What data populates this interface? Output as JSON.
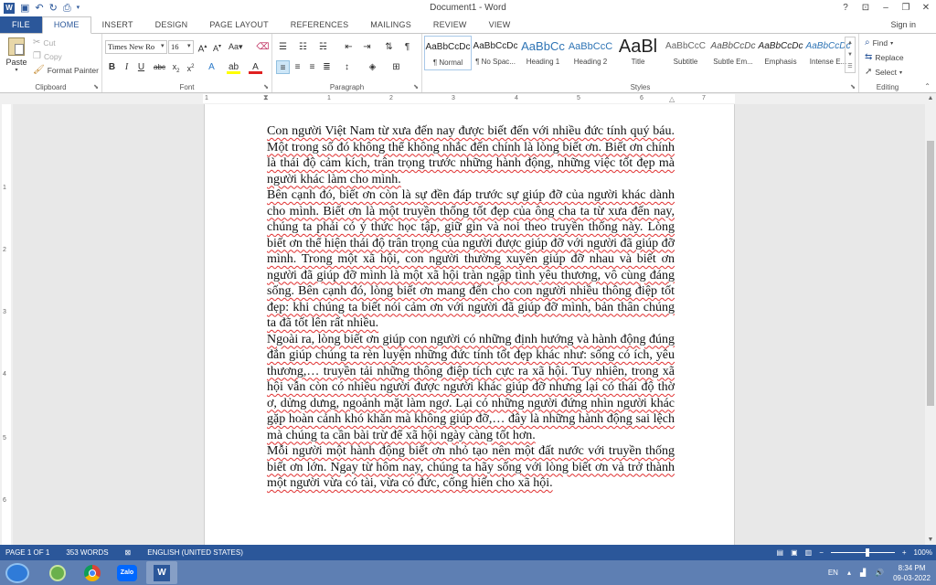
{
  "app": {
    "title": "Document1 - Word",
    "signin": "Sign in"
  },
  "colors": {
    "accent": "#2b579a",
    "taskbar": "#5e7fb3",
    "spell_error": "#e03030"
  },
  "quick_access": [
    "word-icon",
    "save-icon",
    "undo-icon",
    "redo-icon",
    "print-preview-icon"
  ],
  "tabs": [
    "FILE",
    "HOME",
    "INSERT",
    "DESIGN",
    "PAGE LAYOUT",
    "REFERENCES",
    "MAILINGS",
    "REVIEW",
    "VIEW"
  ],
  "ribbon": {
    "clipboard": {
      "label": "Clipboard",
      "paste": "Paste",
      "cut": "Cut",
      "copy": "Copy",
      "format_painter": "Format Painter"
    },
    "font": {
      "label": "Font",
      "name": "Times New Ro",
      "size": "16"
    },
    "paragraph": {
      "label": "Paragraph"
    },
    "styles": {
      "label": "Styles",
      "items": [
        {
          "preview": "AaBbCcDc",
          "name": "¶ Normal"
        },
        {
          "preview": "AaBbCcDc",
          "name": "¶ No Spac..."
        },
        {
          "preview": "AaBbCc",
          "name": "Heading 1"
        },
        {
          "preview": "AaBbCcC",
          "name": "Heading 2"
        },
        {
          "preview": "AaBl",
          "name": "Title"
        },
        {
          "preview": "AaBbCcC",
          "name": "Subtitle"
        },
        {
          "preview": "AaBbCcDc",
          "name": "Subtle Em..."
        },
        {
          "preview": "AaBbCcDc",
          "name": "Emphasis"
        },
        {
          "preview": "AaBbCcDc",
          "name": "Intense E..."
        }
      ]
    },
    "editing": {
      "label": "Editing",
      "find": "Find",
      "replace": "Replace",
      "select": "Select"
    }
  },
  "ruler": {
    "h_numbers": [
      "1",
      "1",
      "2",
      "3",
      "4",
      "5",
      "6",
      "7"
    ],
    "v_numbers": [
      "1",
      "2",
      "3",
      "4",
      "5",
      "6"
    ]
  },
  "document": {
    "paragraphs": [
      "Con người Việt Nam từ xưa đến nay được biết đến với nhiều đức tính quý báu. Một trong số đó không thể không nhắc đến chính là lòng biết ơn. Biết ơn chính là thái độ cảm kích, trân trọng trước những hành động, những việc tốt đẹp mà người khác làm cho mình.",
      "Bên cạnh đó, biết ơn còn là sự đền đáp trước sự giúp đỡ của người khác dành cho mình. Biết ơn là một truyền thống tốt đẹp của ông cha ta từ xưa đến nay, chúng ta phải có ý thức học tập, giữ gìn và noi theo truyền thống này. Lòng biết ơn thể hiện thái độ trân trọng của người được giúp đỡ với người đã giúp đỡ mình. Trong một xã hội, con người thường xuyên giúp đỡ nhau và biết ơn người đã giúp đỡ mình là một xã hội tràn ngập tình yêu thương, vô cùng đáng sống. Bên cạnh đó, lòng biết ơn mang đến cho con người nhiều thông điệp tốt đẹp: khi chúng ta biết nói cảm ơn với người đã giúp đỡ mình, bản thân chúng ta đã tốt lên rất nhiều.",
      "Ngoài ra, lòng biết ơn giúp con người có những định hướng và hành động đúng đắn giúp chúng ta rèn luyện những đức tính tốt đẹp khác như: sống có ích, yêu thương,… truyền tải những thông điệp tích cực ra xã hội. Tuy nhiên, trong xã hội vẫn còn có nhiều người được người khác giúp đỡ nhưng lại có thái độ thờ ơ, dửng dưng, ngoảnh mặt làm ngơ. Lại có những người đứng nhìn người khác gặp hoàn cảnh khó khăn mà không giúp đỡ,… đây là những hành động sai lệch mà chúng ta cần bài trừ để xã hội ngày càng tốt hơn.",
      "Mỗi người một hành động biết ơn nhỏ tạo nên một đất nước với truyền thống biết ơn lớn. Ngay từ hôm nay, chúng ta hãy sống với lòng biết ơn và trở thành một người vừa có tài, vừa có đức, cống hiến cho xã hội."
    ]
  },
  "status": {
    "page": "PAGE 1 OF 1",
    "words": "353 WORDS",
    "language": "ENGLISH (UNITED STATES)",
    "zoom": "100%",
    "zoom_percent": 100
  },
  "taskbar": {
    "apps": [
      "windows-start-icon",
      "app-icon",
      "chrome-icon",
      "zalo-icon",
      "word-icon"
    ],
    "zalo_label": "Zalo",
    "language": "EN",
    "time": "8:34 PM",
    "date": "09-03-2022"
  }
}
